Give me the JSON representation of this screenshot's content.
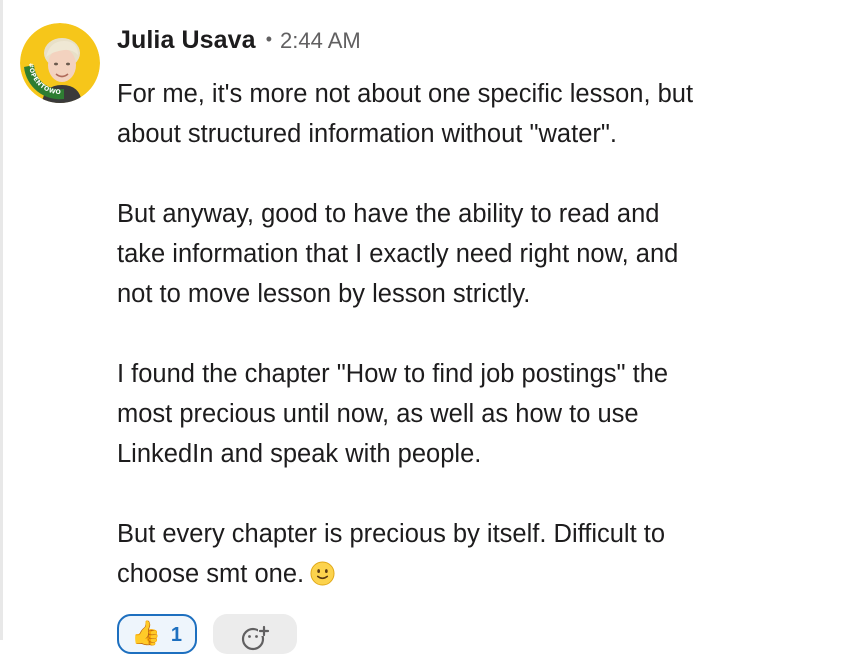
{
  "message": {
    "sender": "Julia Usava",
    "separator": "•",
    "timestamp": "2:44 AM",
    "avatar": {
      "icon": "user-avatar-opentowork",
      "badge_text": "#OPENTOWORK",
      "ring_color": "#2e7d32",
      "background_color": "#f6c61a"
    },
    "paragraphs": [
      [
        "For me, it's more not about one specific lesson, but",
        "about structured information without \"water\"."
      ],
      [
        "But anyway, good to have the ability to read and",
        "take information that I exactly need right now, and",
        "not to move lesson by lesson strictly."
      ],
      [
        "I found the chapter \"How to find job postings\" the",
        "most precious until now, as well as how to use",
        "LinkedIn and speak with people."
      ],
      [
        "But every chapter is precious by itself. Difficult to",
        "choose smt one."
      ]
    ],
    "trailing_emoji": "slightly-smiling-face"
  },
  "reactions": [
    {
      "emoji": "👍",
      "count": "1",
      "selected": true
    }
  ],
  "add_reaction": {
    "icon": "add-reaction-icon"
  },
  "colors": {
    "text": "#1d1c1d",
    "muted": "#616061",
    "accent": "#1d6fbf"
  }
}
